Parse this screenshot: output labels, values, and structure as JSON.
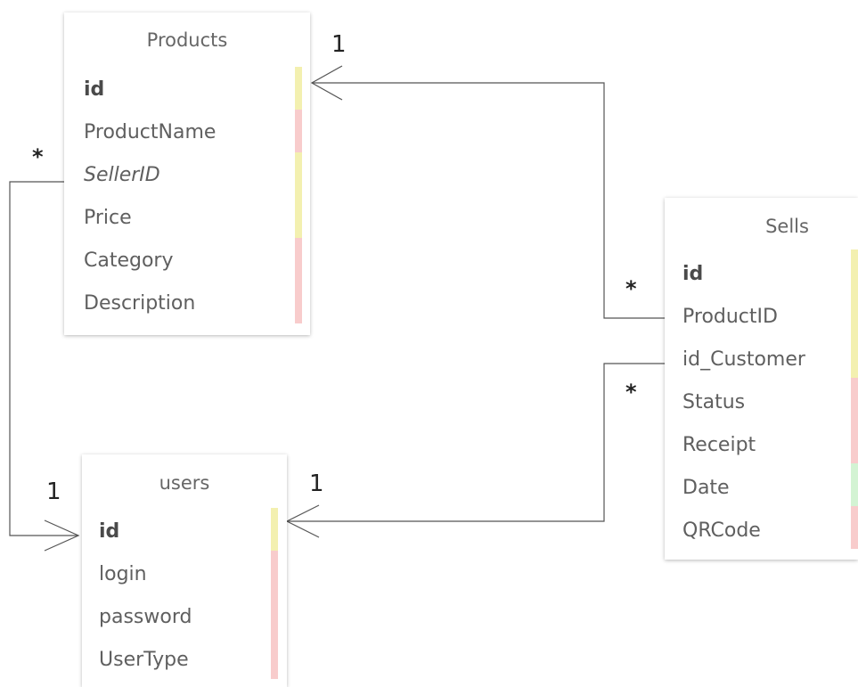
{
  "colors": {
    "key_strip": "#f3f0b0",
    "required_strip": "#f8cccc",
    "optional_strip": "#d3f3d3",
    "line": "#555555"
  },
  "entities": {
    "products": {
      "title": "Products",
      "fields": [
        {
          "name": "id",
          "kind": "pk",
          "strip": "key"
        },
        {
          "name": "ProductName",
          "kind": "normal",
          "strip": "required"
        },
        {
          "name": "SellerID",
          "kind": "fk",
          "strip": "key"
        },
        {
          "name": "Price",
          "kind": "normal",
          "strip": "key"
        },
        {
          "name": "Category",
          "kind": "normal",
          "strip": "required"
        },
        {
          "name": "Description",
          "kind": "normal",
          "strip": "required"
        }
      ]
    },
    "users": {
      "title": "users",
      "fields": [
        {
          "name": "id",
          "kind": "pk",
          "strip": "key"
        },
        {
          "name": "login",
          "kind": "normal",
          "strip": "required"
        },
        {
          "name": "password",
          "kind": "normal",
          "strip": "required"
        },
        {
          "name": "UserType",
          "kind": "normal",
          "strip": "required"
        }
      ]
    },
    "sells": {
      "title": "Sells",
      "fields": [
        {
          "name": "id",
          "kind": "pk",
          "strip": "key"
        },
        {
          "name": "ProductID",
          "kind": "normal",
          "strip": "key"
        },
        {
          "name": "id_Customer",
          "kind": "normal",
          "strip": "key"
        },
        {
          "name": "Status",
          "kind": "normal",
          "strip": "required"
        },
        {
          "name": "Receipt",
          "kind": "normal",
          "strip": "required"
        },
        {
          "name": "Date",
          "kind": "normal",
          "strip": "optional"
        },
        {
          "name": "QRCode",
          "kind": "normal",
          "strip": "required"
        }
      ]
    }
  },
  "relations": [
    {
      "from": "products.SellerID",
      "to": "users.id",
      "from_cardinality": "*",
      "to_cardinality": "1"
    },
    {
      "from": "sells.ProductID",
      "to": "products.id",
      "from_cardinality": "*",
      "to_cardinality": "1"
    },
    {
      "from": "sells.id_Customer",
      "to": "users.id",
      "from_cardinality": "*",
      "to_cardinality": "1"
    }
  ]
}
